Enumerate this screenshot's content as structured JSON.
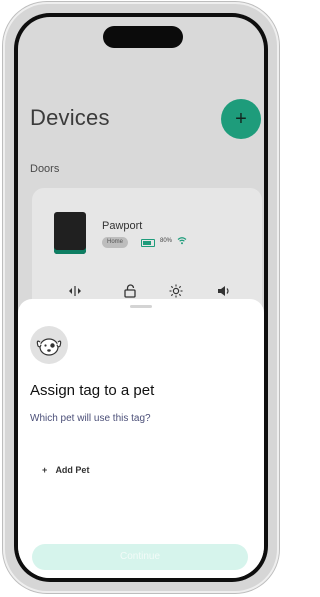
{
  "header": {
    "title": "Devices"
  },
  "section": {
    "doors_label": "Doors"
  },
  "device": {
    "name": "Pawport",
    "tag": "Home",
    "battery": "80%"
  },
  "controls": {
    "icons": [
      "sensor-icon",
      "unlock-icon",
      "brightness-icon",
      "volume-icon"
    ]
  },
  "sheet": {
    "title": "Assign tag to a pet",
    "subtitle": "Which pet will use this tag?",
    "add_pet_label": "Add Pet",
    "continue_label": "Continue"
  },
  "colors": {
    "accent": "#1e9c7b",
    "accent_disabled": "#d6f4ec",
    "subtitle": "#4b4f78"
  }
}
